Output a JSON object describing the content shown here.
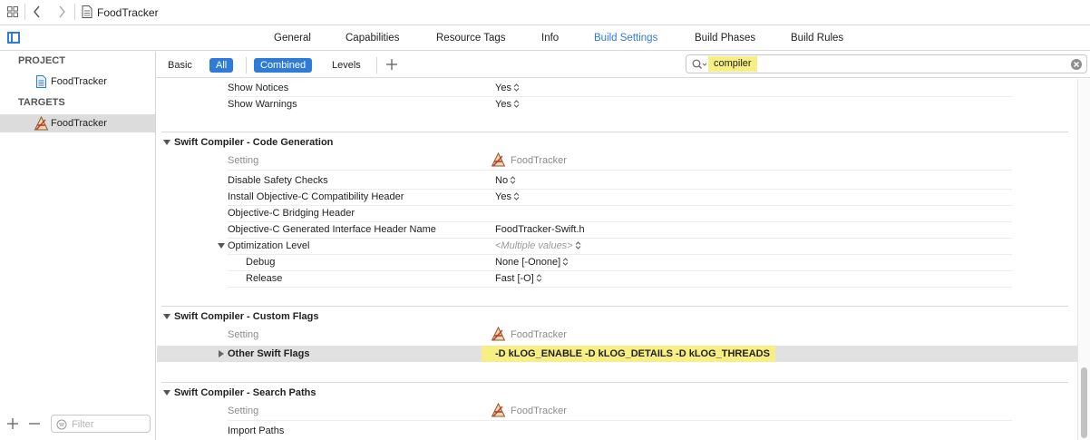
{
  "breadcrumb": {
    "file": "FoodTracker"
  },
  "tabs": [
    "General",
    "Capabilities",
    "Resource Tags",
    "Info",
    "Build Settings",
    "Build Phases",
    "Build Rules"
  ],
  "active_tab": "Build Settings",
  "sidebar": {
    "project_header": "PROJECT",
    "project_item": "FoodTracker",
    "targets_header": "TARGETS",
    "target_item": "FoodTracker",
    "filter_placeholder": "Filter"
  },
  "filterbar": {
    "basic": "Basic",
    "all": "All",
    "combined": "Combined",
    "levels": "Levels",
    "search_value": "compiler"
  },
  "settings": {
    "top_rows": [
      {
        "name": "Show Notices",
        "value": "Yes"
      },
      {
        "name": "Show Warnings",
        "value": "Yes"
      }
    ],
    "codegen": {
      "title": "Swift Compiler - Code Generation",
      "setting_label": "Setting",
      "target_label": "FoodTracker",
      "rows": [
        {
          "name": "Disable Safety Checks",
          "value": "No"
        },
        {
          "name": "Install Objective-C Compatibility Header",
          "value": "Yes"
        },
        {
          "name": "Objective-C Bridging Header",
          "value": ""
        },
        {
          "name": "Objective-C Generated Interface Header Name",
          "value": "FoodTracker-Swift.h"
        },
        {
          "name": "Optimization Level",
          "value": "<Multiple values>"
        },
        {
          "name": "Debug",
          "value": "None [-Onone]"
        },
        {
          "name": "Release",
          "value": "Fast [-O]"
        }
      ]
    },
    "custom_flags": {
      "title": "Swift Compiler - Custom Flags",
      "setting_label": "Setting",
      "target_label": "FoodTracker",
      "rows": [
        {
          "name": "Other Swift Flags",
          "value": "-D kLOG_ENABLE -D kLOG_DETAILS -D kLOG_THREADS"
        }
      ]
    },
    "search_paths": {
      "title": "Swift Compiler - Search Paths",
      "setting_label": "Setting",
      "target_label": "FoodTracker",
      "rows": [
        {
          "name": "Import Paths",
          "value": ""
        }
      ]
    }
  },
  "colors": {
    "accent": "#2f7bd8",
    "highlight": "#f7ef83",
    "selected_row": "#e1e1e1"
  }
}
